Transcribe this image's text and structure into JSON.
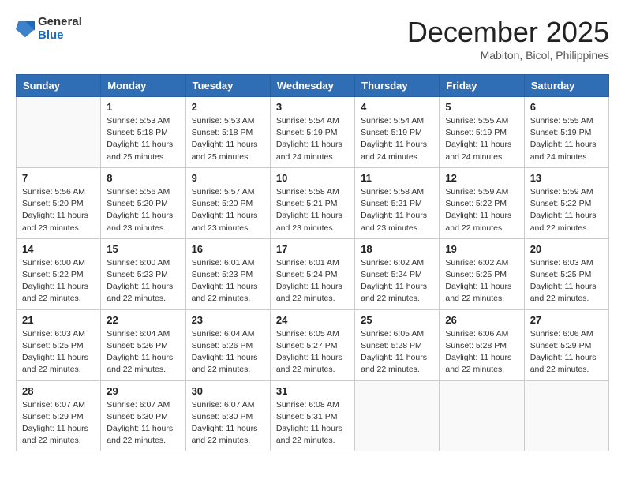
{
  "logo": {
    "general": "General",
    "blue": "Blue"
  },
  "header": {
    "month": "December 2025",
    "location": "Mabiton, Bicol, Philippines"
  },
  "weekdays": [
    "Sunday",
    "Monday",
    "Tuesday",
    "Wednesday",
    "Thursday",
    "Friday",
    "Saturday"
  ],
  "weeks": [
    [
      {
        "day": "",
        "info": ""
      },
      {
        "day": "1",
        "info": "Sunrise: 5:53 AM\nSunset: 5:18 PM\nDaylight: 11 hours\nand 25 minutes."
      },
      {
        "day": "2",
        "info": "Sunrise: 5:53 AM\nSunset: 5:18 PM\nDaylight: 11 hours\nand 25 minutes."
      },
      {
        "day": "3",
        "info": "Sunrise: 5:54 AM\nSunset: 5:19 PM\nDaylight: 11 hours\nand 24 minutes."
      },
      {
        "day": "4",
        "info": "Sunrise: 5:54 AM\nSunset: 5:19 PM\nDaylight: 11 hours\nand 24 minutes."
      },
      {
        "day": "5",
        "info": "Sunrise: 5:55 AM\nSunset: 5:19 PM\nDaylight: 11 hours\nand 24 minutes."
      },
      {
        "day": "6",
        "info": "Sunrise: 5:55 AM\nSunset: 5:19 PM\nDaylight: 11 hours\nand 24 minutes."
      }
    ],
    [
      {
        "day": "7",
        "info": "Sunrise: 5:56 AM\nSunset: 5:20 PM\nDaylight: 11 hours\nand 23 minutes."
      },
      {
        "day": "8",
        "info": "Sunrise: 5:56 AM\nSunset: 5:20 PM\nDaylight: 11 hours\nand 23 minutes."
      },
      {
        "day": "9",
        "info": "Sunrise: 5:57 AM\nSunset: 5:20 PM\nDaylight: 11 hours\nand 23 minutes."
      },
      {
        "day": "10",
        "info": "Sunrise: 5:58 AM\nSunset: 5:21 PM\nDaylight: 11 hours\nand 23 minutes."
      },
      {
        "day": "11",
        "info": "Sunrise: 5:58 AM\nSunset: 5:21 PM\nDaylight: 11 hours\nand 23 minutes."
      },
      {
        "day": "12",
        "info": "Sunrise: 5:59 AM\nSunset: 5:22 PM\nDaylight: 11 hours\nand 22 minutes."
      },
      {
        "day": "13",
        "info": "Sunrise: 5:59 AM\nSunset: 5:22 PM\nDaylight: 11 hours\nand 22 minutes."
      }
    ],
    [
      {
        "day": "14",
        "info": "Sunrise: 6:00 AM\nSunset: 5:22 PM\nDaylight: 11 hours\nand 22 minutes."
      },
      {
        "day": "15",
        "info": "Sunrise: 6:00 AM\nSunset: 5:23 PM\nDaylight: 11 hours\nand 22 minutes."
      },
      {
        "day": "16",
        "info": "Sunrise: 6:01 AM\nSunset: 5:23 PM\nDaylight: 11 hours\nand 22 minutes."
      },
      {
        "day": "17",
        "info": "Sunrise: 6:01 AM\nSunset: 5:24 PM\nDaylight: 11 hours\nand 22 minutes."
      },
      {
        "day": "18",
        "info": "Sunrise: 6:02 AM\nSunset: 5:24 PM\nDaylight: 11 hours\nand 22 minutes."
      },
      {
        "day": "19",
        "info": "Sunrise: 6:02 AM\nSunset: 5:25 PM\nDaylight: 11 hours\nand 22 minutes."
      },
      {
        "day": "20",
        "info": "Sunrise: 6:03 AM\nSunset: 5:25 PM\nDaylight: 11 hours\nand 22 minutes."
      }
    ],
    [
      {
        "day": "21",
        "info": "Sunrise: 6:03 AM\nSunset: 5:25 PM\nDaylight: 11 hours\nand 22 minutes."
      },
      {
        "day": "22",
        "info": "Sunrise: 6:04 AM\nSunset: 5:26 PM\nDaylight: 11 hours\nand 22 minutes."
      },
      {
        "day": "23",
        "info": "Sunrise: 6:04 AM\nSunset: 5:26 PM\nDaylight: 11 hours\nand 22 minutes."
      },
      {
        "day": "24",
        "info": "Sunrise: 6:05 AM\nSunset: 5:27 PM\nDaylight: 11 hours\nand 22 minutes."
      },
      {
        "day": "25",
        "info": "Sunrise: 6:05 AM\nSunset: 5:28 PM\nDaylight: 11 hours\nand 22 minutes."
      },
      {
        "day": "26",
        "info": "Sunrise: 6:06 AM\nSunset: 5:28 PM\nDaylight: 11 hours\nand 22 minutes."
      },
      {
        "day": "27",
        "info": "Sunrise: 6:06 AM\nSunset: 5:29 PM\nDaylight: 11 hours\nand 22 minutes."
      }
    ],
    [
      {
        "day": "28",
        "info": "Sunrise: 6:07 AM\nSunset: 5:29 PM\nDaylight: 11 hours\nand 22 minutes."
      },
      {
        "day": "29",
        "info": "Sunrise: 6:07 AM\nSunset: 5:30 PM\nDaylight: 11 hours\nand 22 minutes."
      },
      {
        "day": "30",
        "info": "Sunrise: 6:07 AM\nSunset: 5:30 PM\nDaylight: 11 hours\nand 22 minutes."
      },
      {
        "day": "31",
        "info": "Sunrise: 6:08 AM\nSunset: 5:31 PM\nDaylight: 11 hours\nand 22 minutes."
      },
      {
        "day": "",
        "info": ""
      },
      {
        "day": "",
        "info": ""
      },
      {
        "day": "",
        "info": ""
      }
    ]
  ]
}
